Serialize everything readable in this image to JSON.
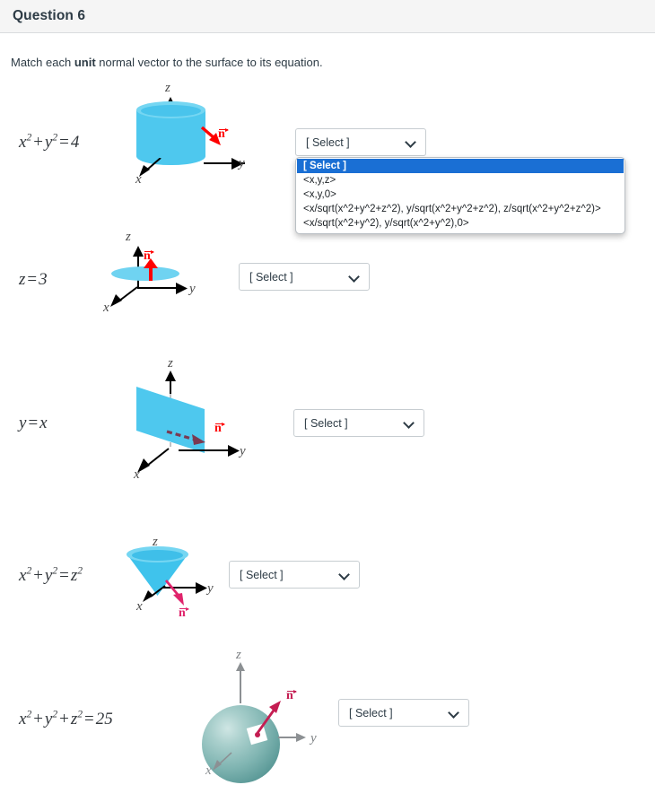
{
  "header": {
    "title": "Question 6"
  },
  "prompt": {
    "before": "Match each ",
    "bold": "unit",
    "after": " normal vector to the surface to its equation."
  },
  "select": {
    "placeholder": "[ Select ]",
    "options": [
      "[ Select ]",
      "<x,y,z>",
      "<x,y,0>",
      "<x/sqrt(x^2+y^2+z^2), y/sqrt(x^2+y^2+z^2), z/sqrt(x^2+y^2+z^2)>",
      "<x/sqrt(x^2+y^2), y/sqrt(x^2+y^2),0>"
    ],
    "selected_option": "[ Select ]"
  },
  "rows": [
    {
      "equation_text": "x² + y² = 4",
      "surface": "cylinder",
      "normal_label": "n",
      "normal_color": "#ff0000",
      "dropdown_open": true,
      "axis_labels": {
        "z": "z",
        "y": "y",
        "x": "x"
      }
    },
    {
      "equation_text": "z = 3",
      "surface": "disk-plane",
      "normal_label": "n",
      "normal_color": "#ff0000",
      "dropdown_open": false,
      "axis_labels": {
        "z": "z",
        "y": "y",
        "x": "x"
      }
    },
    {
      "equation_text": "y = x",
      "surface": "vertical-plane",
      "normal_label": "n",
      "normal_color": "#ff0000",
      "dropdown_open": false,
      "axis_labels": {
        "z": "z",
        "y": "y",
        "x": "x"
      }
    },
    {
      "equation_text": "x² + y² = z²",
      "surface": "cone",
      "normal_label": "n",
      "normal_color": "#e0246c",
      "dropdown_open": false,
      "axis_labels": {
        "z": "z",
        "y": "y",
        "x": "x"
      }
    },
    {
      "equation_text": "x² + y² + z² = 25",
      "surface": "sphere",
      "normal_label": "n",
      "normal_color": "#c41d52",
      "dropdown_open": false,
      "axis_labels": {
        "z": "z",
        "y": "y",
        "x": "x"
      }
    }
  ],
  "colors": {
    "header_bg": "#f5f5f5",
    "text": "#2d3b45",
    "surface_cyan": "#4ec8ee",
    "sphere_teal": "#80b5b2",
    "highlight_blue": "#1a6fd4",
    "normal_red": "#ff0000",
    "normal_crimson": "#c41d52"
  }
}
